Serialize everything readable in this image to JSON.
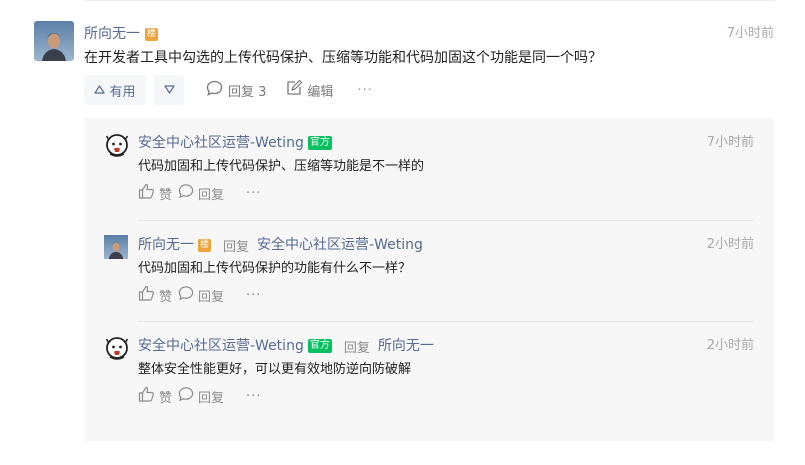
{
  "main_comment": {
    "author": "所向无一",
    "floor_badge": "楼",
    "time": "7小时前",
    "content": "在开发者工具中勾选的上传代码保护、压缩等功能和代码加固这个功能是同一个吗？",
    "useful_label": "有用",
    "reply_label": "回复 3",
    "edit_label": "编辑",
    "more_label": "···"
  },
  "replies": [
    {
      "author": "安全中心社区运营-Weting",
      "official_badge": "官方",
      "time": "7小时前",
      "content": "代码加固和上传代码保护、压缩等功能是不一样的",
      "like_label": "赞",
      "reply_label": "回复",
      "more_label": "···"
    },
    {
      "author": "所向无一",
      "floor_badge": "楼",
      "reply_word": "回复",
      "reply_target": "安全中心社区运营-Weting",
      "time": "2小时前",
      "content": "代码加固和上传代码保护的功能有什么不一样？",
      "like_label": "赞",
      "reply_label": "回复",
      "more_label": "···"
    },
    {
      "author": "安全中心社区运营-Weting",
      "official_badge": "官方",
      "reply_word": "回复",
      "reply_target": "所向无一",
      "time": "2小时前",
      "content": "整体安全性能更好，可以更有效地防逆向防破解",
      "like_label": "赞",
      "reply_label": "回复",
      "more_label": "···"
    }
  ],
  "colors": {
    "link_blue": "#576b95",
    "floor_badge": "#f0a33b",
    "official_badge": "#07c160",
    "panel_bg": "#f7f7f7"
  },
  "icons": {
    "thumb_up": "thumb-up-icon",
    "thumb_down": "thumb-down-icon",
    "comment": "comment-icon",
    "edit": "edit-icon",
    "like": "like-icon",
    "security_logo": "security-center-logo-icon"
  }
}
